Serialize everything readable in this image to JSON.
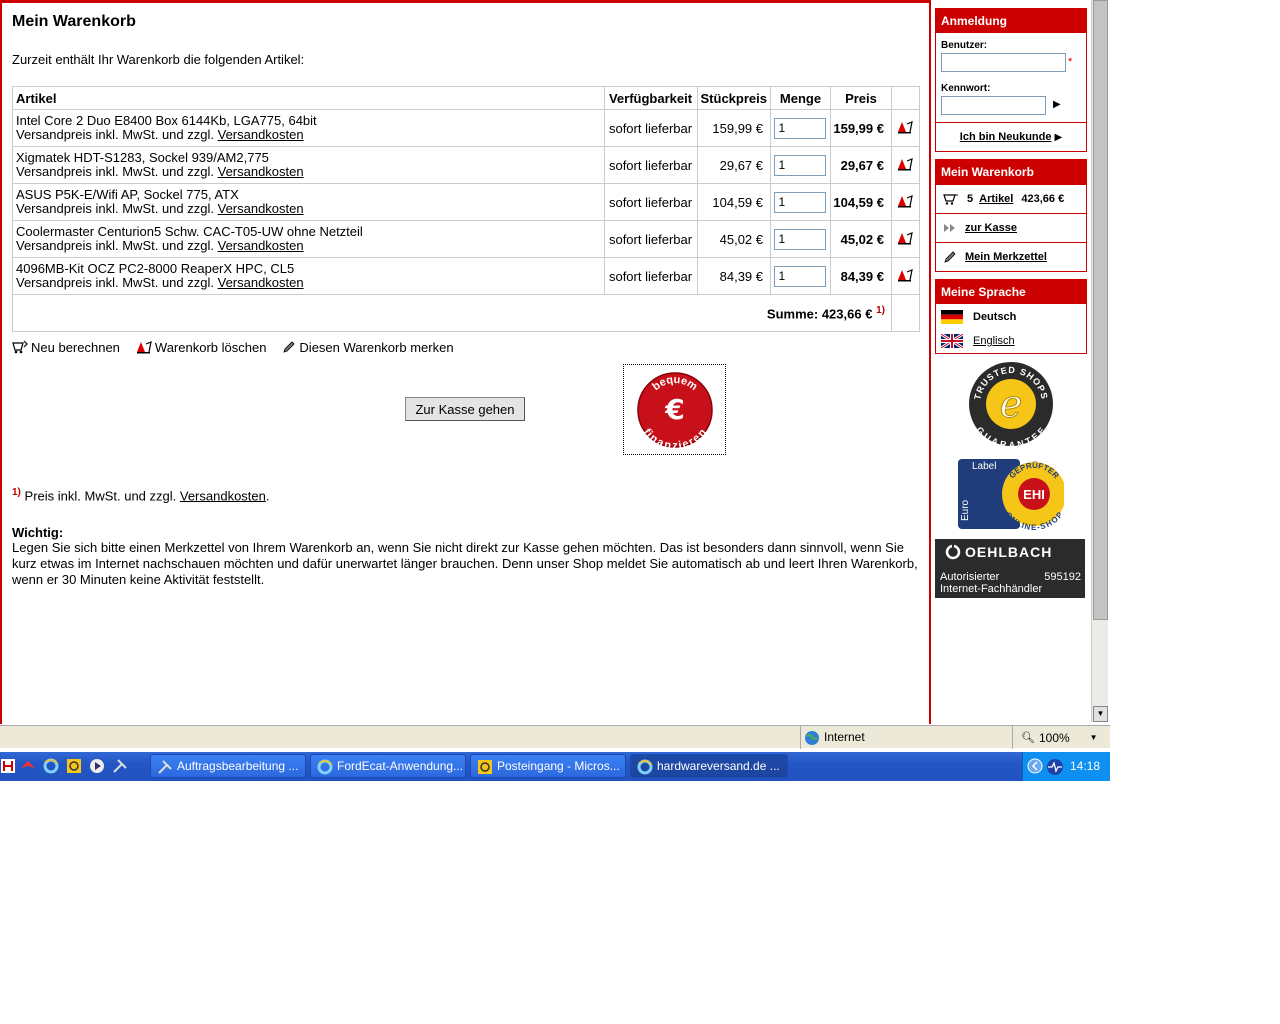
{
  "cart": {
    "title": "Mein Warenkorb",
    "intro": "Zurzeit enthält Ihr Warenkorb die folgenden Artikel:",
    "columns": {
      "article": "Artikel",
      "availability": "Verfügbarkeit",
      "unit_price": "Stückpreis",
      "quantity": "Menge",
      "price": "Preis"
    },
    "items": [
      {
        "name": "Intel Core 2 Duo E8400 Box 6144Kb, LGA775, 64bit",
        "shipping_prefix": "Versandpreis inkl. MwSt. und zzgl.",
        "shipping_link": "Versandkosten",
        "availability": "sofort lieferbar",
        "unit_price": "159,99 €",
        "quantity": "1",
        "price": "159,99 €"
      },
      {
        "name": "Xigmatek HDT-S1283, Sockel 939/AM2,775",
        "shipping_prefix": "Versandpreis inkl. MwSt. und zzgl.",
        "shipping_link": "Versandkosten",
        "availability": "sofort lieferbar",
        "unit_price": "29,67 €",
        "quantity": "1",
        "price": "29,67 €"
      },
      {
        "name": "ASUS P5K-E/Wifi AP, Sockel 775, ATX",
        "shipping_prefix": "Versandpreis inkl. MwSt. und zzgl.",
        "shipping_link": "Versandkosten",
        "availability": "sofort lieferbar",
        "unit_price": "104,59 €",
        "quantity": "1",
        "price": "104,59 €"
      },
      {
        "name": "Coolermaster Centurion5 Schw. CAC-T05-UW ohne Netzteil",
        "shipping_prefix": "Versandpreis inkl. MwSt. und zzgl.",
        "shipping_link": "Versandkosten",
        "availability": "sofort lieferbar",
        "unit_price": "45,02 €",
        "quantity": "1",
        "price": "45,02 €"
      },
      {
        "name": "4096MB-Kit OCZ PC2-8000 ReaperX HPC, CL5",
        "shipping_prefix": "Versandpreis inkl. MwSt. und zzgl.",
        "shipping_link": "Versandkosten",
        "availability": "sofort lieferbar",
        "unit_price": "84,39 €",
        "quantity": "1",
        "price": "84,39 €"
      }
    ],
    "sum_label": "Summe: 423,66 €",
    "footnote_mark": "1)",
    "actions": {
      "recalculate": "Neu berechnen",
      "delete": "Warenkorb löschen",
      "remember": "Diesen Warenkorb merken"
    },
    "checkout_button": "Zur Kasse gehen",
    "finance_badge": {
      "top": "bequem",
      "bottom": "finanzieren",
      "symbol": "€"
    },
    "footnote": {
      "mark": "1)",
      "text": "Preis inkl. MwSt. und zzgl.",
      "link": "Versandkosten",
      "end": "."
    },
    "important_heading": "Wichtig:",
    "important_text": "Legen Sie sich bitte einen Merkzettel von Ihrem Warenkorb an, wenn Sie nicht direkt zur Kasse gehen möchten. Das ist besonders dann sinnvoll, wenn Sie kurz etwas im Internet nachschauen möchten und dafür unerwartet länger brauchen. Denn unser Shop meldet Sie automatisch ab und leert Ihren Warenkorb, wenn er 30 Minuten keine Aktivität feststellt."
  },
  "sidebar": {
    "login": {
      "title": "Anmeldung",
      "user_label": "Benutzer:",
      "password_label": "Kennwort:",
      "required_mark": "*",
      "new_customer": "Ich bin Neukunde"
    },
    "mini_cart": {
      "title": "Mein Warenkorb",
      "count": "5",
      "articles_link": "Artikel",
      "total": "423,66 €",
      "checkout_link": "zur Kasse",
      "wishlist_link": "Mein Merkzettel"
    },
    "language": {
      "title": "Meine Sprache",
      "german": "Deutsch",
      "english": "Englisch"
    },
    "trusted_shops": {
      "top": "TRUSTED SHOPS",
      "bottom": "GUARANTEE",
      "letter": "e"
    },
    "ehi": {
      "euro": "Euro",
      "label": "Label",
      "top": "GEPRÜFTER",
      "center": "EHI",
      "bottom": "ONLINE-SHOP"
    },
    "oehlbach": {
      "brand": "OEHLBACH",
      "line1": "Autorisierter",
      "number": "595192",
      "line2": "Internet-Fachhändler"
    }
  },
  "statusbar": {
    "zone": "Internet",
    "zoom": "100%"
  },
  "taskbar": {
    "buttons": [
      {
        "label": "Auftragsbearbeitung ..."
      },
      {
        "label": "FordEcat-Anwendung..."
      },
      {
        "label": "Posteingang - Micros..."
      },
      {
        "label": "hardwareversand.de ..."
      }
    ],
    "clock": "14:18"
  },
  "colors": {
    "brand_red": "#cc0000",
    "taskbar_blue": "#2356c4",
    "tray_blue": "#0f8ff0"
  }
}
